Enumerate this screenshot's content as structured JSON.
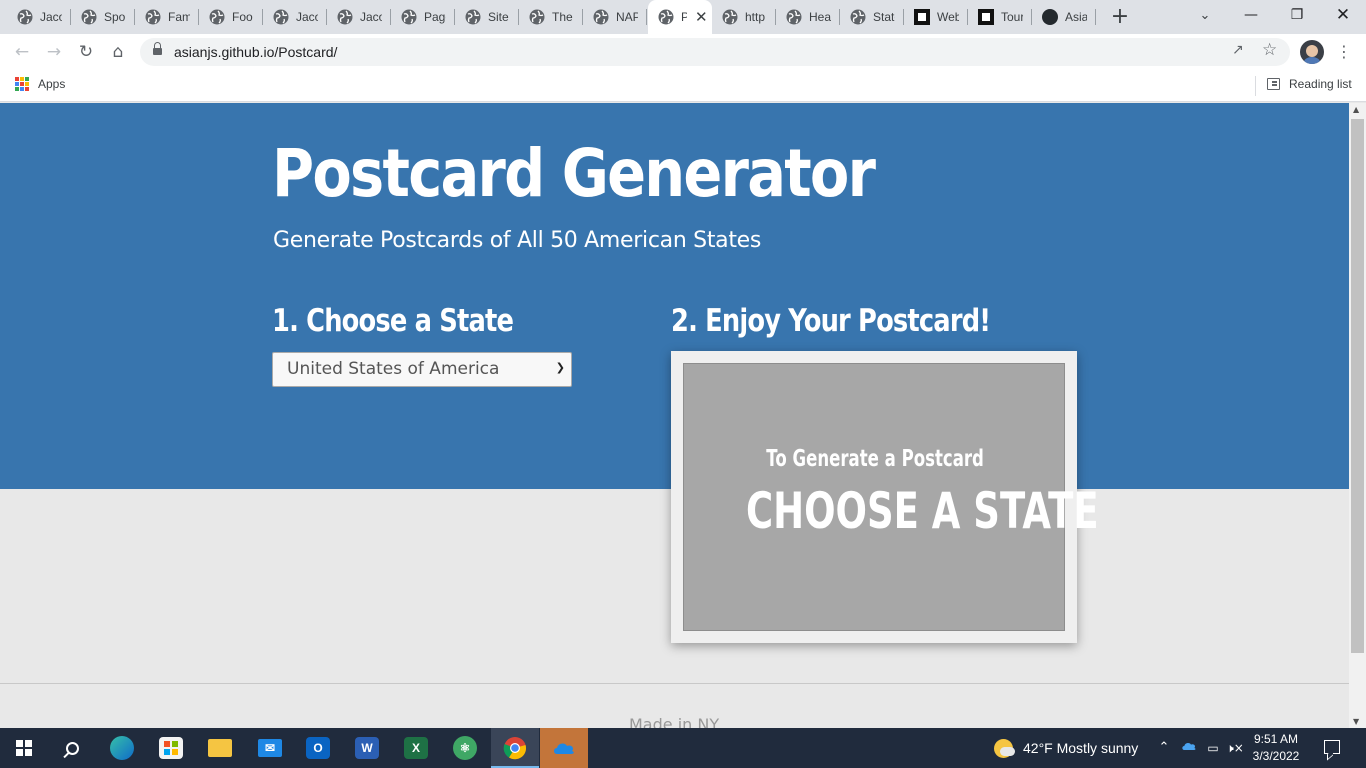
{
  "browser": {
    "tabs": [
      {
        "title": "Jaco",
        "icon": "globe-icon"
      },
      {
        "title": "Spo",
        "icon": "globe-icon"
      },
      {
        "title": "Fam",
        "icon": "globe-icon"
      },
      {
        "title": "Foo",
        "icon": "globe-icon"
      },
      {
        "title": "Jaco",
        "icon": "globe-icon"
      },
      {
        "title": "Jaco",
        "icon": "globe-icon"
      },
      {
        "title": "Page",
        "icon": "globe-icon"
      },
      {
        "title": "Site",
        "icon": "globe-icon"
      },
      {
        "title": "The",
        "icon": "globe-icon"
      },
      {
        "title": "NAP",
        "icon": "globe-icon"
      },
      {
        "title": "P",
        "icon": "globe-icon",
        "active": true
      },
      {
        "title": "http",
        "icon": "globe-icon"
      },
      {
        "title": "Heal",
        "icon": "globe-icon"
      },
      {
        "title": "State",
        "icon": "globe-icon"
      },
      {
        "title": "Web",
        "icon": "square-logo-icon"
      },
      {
        "title": "Tour",
        "icon": "square-logo-icon"
      },
      {
        "title": "Asia",
        "icon": "github-icon"
      }
    ],
    "url": "asianjs.github.io/Postcard/",
    "bookmarks": {
      "apps_label": "Apps",
      "reading_list_label": "Reading list"
    }
  },
  "page": {
    "title": "Postcard Generator",
    "subtitle": "Generate Postcards of All 50 American States",
    "step1_heading": "1. Choose a State",
    "step2_heading": "2. Enjoy Your Postcard!",
    "state_select": {
      "selected": "United States of America"
    },
    "postcard": {
      "small_text": "To Generate a Postcard",
      "big_text": "CHOOSE A STATE"
    },
    "footer": "Made in NY"
  },
  "colors": {
    "hero_bg": "#3875ae",
    "postcard_bg": "#a7a7a7",
    "page_bg": "#e8e8e8"
  },
  "taskbar": {
    "apps": [
      "start-icon",
      "search-icon",
      "edge-icon",
      "store-icon",
      "file-explorer-icon",
      "mail-icon",
      "outlook-icon",
      "word-icon",
      "excel-icon",
      "atom-icon",
      "chrome-icon",
      "onedrive-icon"
    ],
    "weather": "42°F  Mostly sunny",
    "time": "9:51 AM",
    "date": "3/3/2022"
  }
}
